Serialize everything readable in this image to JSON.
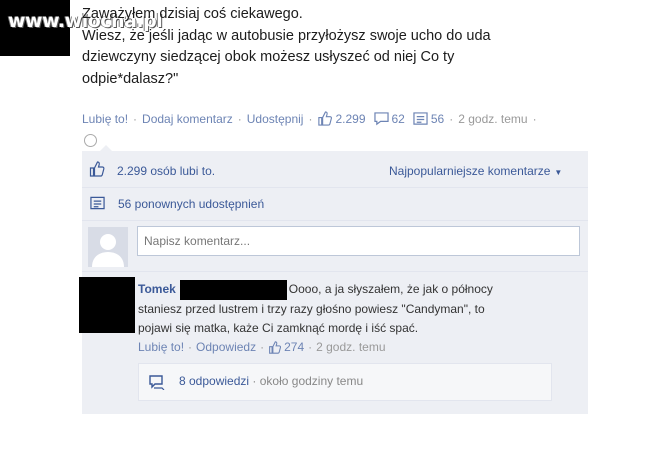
{
  "watermark": "www.wiocha.pl",
  "post": {
    "text_line1": "Zaważyłem dzisiaj coś ciekawego.",
    "text_line2": "Wiesz, że jeśli jadąc w autobusie przyłożysz swoje ucho do uda",
    "text_line3": "dziewczyny siedzącej obok możesz usłyszeć od niej Co ty",
    "text_line4": "odpie*dalasz?\"",
    "actions": {
      "like": "Lubię to!",
      "comment": "Dodaj komentarz",
      "share": "Udostępnij",
      "likes_count": "2.299",
      "comments_count": "62",
      "shares_count": "56",
      "time": "2 godz. temu"
    }
  },
  "ufi": {
    "likes_text": "2.299 osób lubi to.",
    "sort_label": "Najpopularniejsze komentarze",
    "shares_text": "56 ponownych udostępnień",
    "comment_placeholder": "Napisz komentarz..."
  },
  "comment": {
    "author": "Tomek",
    "text_part1": "Oooo, a ja słyszałem, że jak o północy",
    "text_line2": "staniesz przed lustrem i trzy razy głośno powiesz \"Candyman\", to",
    "text_line3": "pojawi się matka, każe Ci zamknąć mordę i iść spać.",
    "like": "Lubię to!",
    "reply": "Odpowiedz",
    "likes_count": "274",
    "time": "2 godz. temu",
    "replies_count": "8 odpowiedzi",
    "replies_time": "około godziny temu"
  },
  "colors": {
    "link": "#3b5998",
    "ufi_bg": "#edeff4",
    "muted": "#999999"
  },
  "icons": [
    "thumbs-up-icon",
    "comment-icon",
    "share-icon",
    "globe-icon",
    "dropdown-icon",
    "reply-icon"
  ]
}
